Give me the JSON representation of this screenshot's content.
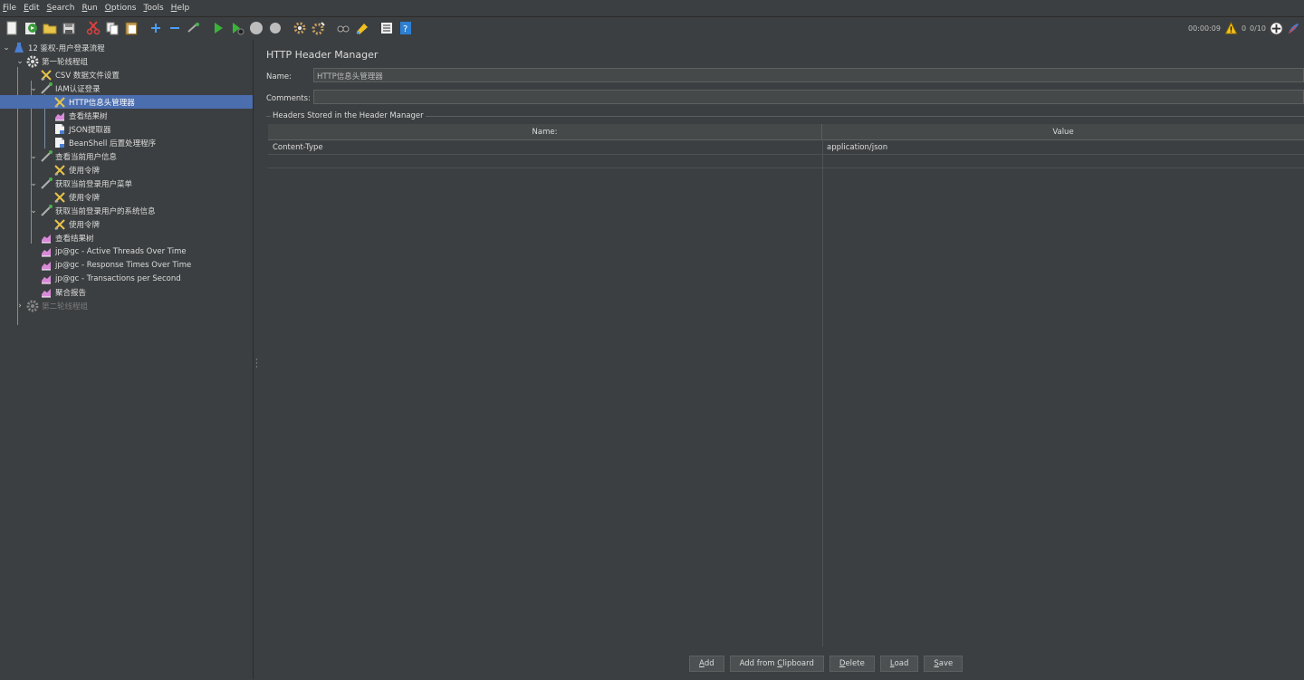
{
  "menu": [
    {
      "mnemonic": "F",
      "rest": "ile"
    },
    {
      "mnemonic": "E",
      "rest": "dit"
    },
    {
      "mnemonic": "S",
      "rest": "earch"
    },
    {
      "mnemonic": "R",
      "rest": "un"
    },
    {
      "mnemonic": "O",
      "rest": "ptions"
    },
    {
      "mnemonic": "T",
      "rest": "ools"
    },
    {
      "mnemonic": "H",
      "rest": "elp"
    }
  ],
  "toolbar_icons": [
    "new-icon",
    "templates-icon",
    "open-icon",
    "save-icon",
    "cut-icon",
    "copy-icon",
    "paste-icon",
    "expand-icon",
    "collapse-icon",
    "toggle-icon",
    "start-icon",
    "start-no-pause-icon",
    "stop-icon",
    "shutdown-icon",
    "clear-icon",
    "clear-all-icon",
    "search-icon",
    "reset-search-icon",
    "function-helper-icon",
    "help-icon"
  ],
  "status": {
    "elapsed_time": "00:00:09",
    "warning_count": "0",
    "threads": "0/10"
  },
  "tree": [
    {
      "label": "12 鉴权-用户登录流程",
      "icon": "test-plan-icon",
      "toggle": "expanded"
    },
    {
      "label": "第一轮线程组",
      "icon": "thread-group-icon",
      "toggle": "expanded"
    },
    {
      "label": "CSV 数据文件设置",
      "icon": "config-element-icon",
      "toggle": ""
    },
    {
      "label": "IAM认证登录",
      "icon": "sampler-icon",
      "toggle": "expanded"
    },
    {
      "label": "HTTP信息头管理器",
      "icon": "config-element-icon",
      "toggle": "",
      "selected": true
    },
    {
      "label": "查看结果树",
      "icon": "listener-icon",
      "toggle": ""
    },
    {
      "label": "JSON提取器",
      "icon": "extractor-icon",
      "toggle": ""
    },
    {
      "label": "BeanShell 后置处理程序",
      "icon": "extractor-icon",
      "toggle": ""
    },
    {
      "label": "查看当前用户信息",
      "icon": "sampler-icon",
      "toggle": "expanded"
    },
    {
      "label": "使用令牌",
      "icon": "config-element-icon",
      "toggle": ""
    },
    {
      "label": "获取当前登录用户菜单",
      "icon": "sampler-icon",
      "toggle": "expanded"
    },
    {
      "label": "使用令牌",
      "icon": "config-element-icon",
      "toggle": ""
    },
    {
      "label": "获取当前登录用户的系统信息",
      "icon": "sampler-icon",
      "toggle": "expanded"
    },
    {
      "label": "使用令牌",
      "icon": "config-element-icon",
      "toggle": ""
    },
    {
      "label": "查看结果树",
      "icon": "listener-icon",
      "toggle": ""
    },
    {
      "label": "jp@gc - Active Threads Over Time",
      "icon": "listener-icon",
      "toggle": ""
    },
    {
      "label": "jp@gc - Response Times Over Time",
      "icon": "listener-icon",
      "toggle": ""
    },
    {
      "label": "jp@gc - Transactions per Second",
      "icon": "listener-icon",
      "toggle": ""
    },
    {
      "label": "聚合报告",
      "icon": "listener-icon",
      "toggle": ""
    },
    {
      "label": "第二轮线程组",
      "icon": "thread-group-icon",
      "toggle": "collapsed",
      "disabled": true
    }
  ],
  "main": {
    "title": "HTTP Header Manager",
    "name_label": "Name:",
    "name_value": "HTTP信息头管理器",
    "comments_label": "Comments:",
    "comments_value": "",
    "group_title": "Headers Stored in the Header Manager",
    "columns": [
      "Name:",
      "Value"
    ],
    "rows": [
      [
        "Content-Type",
        "application/json"
      ],
      [
        "",
        ""
      ]
    ]
  },
  "buttons": [
    {
      "mnemonic": "A",
      "rest": "dd",
      "prefix": ""
    },
    {
      "mnemonic": "C",
      "rest": "lipboard",
      "prefix": "Add from "
    },
    {
      "mnemonic": "D",
      "rest": "elete",
      "prefix": ""
    },
    {
      "mnemonic": "L",
      "rest": "oad",
      "prefix": ""
    },
    {
      "mnemonic": "S",
      "rest": "ave",
      "prefix": ""
    }
  ]
}
